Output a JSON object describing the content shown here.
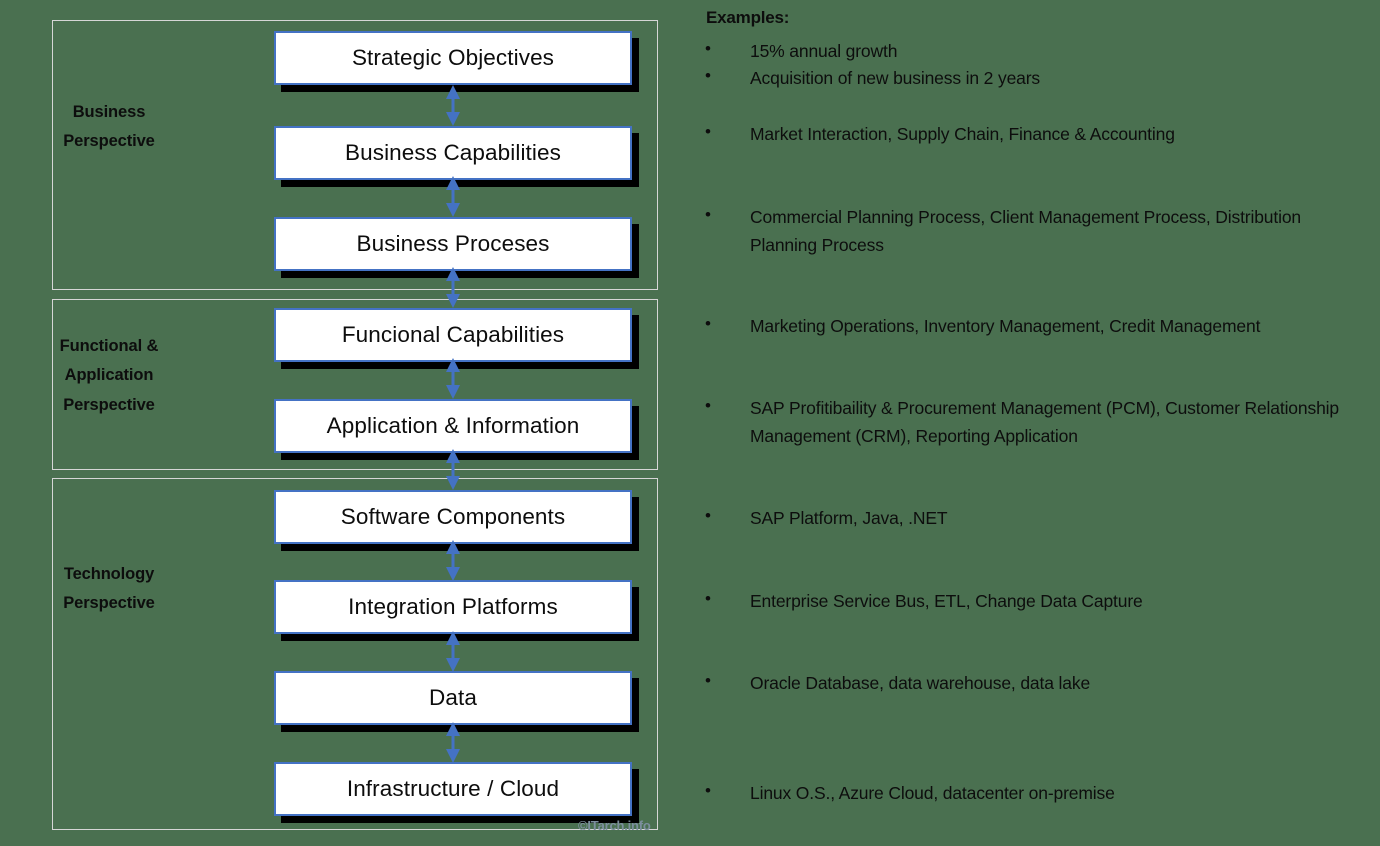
{
  "colors": {
    "background_green": "#4a7050",
    "panel_border": "#d6d6d6",
    "box_border_blue": "#4472c4",
    "box_fill": "#ffffff",
    "box_shadow": "#000000",
    "arrow_blue": "#4472c4",
    "text_dark": "#0d0d0d",
    "watermark": "#7c8f9e"
  },
  "diagram": {
    "perspectives": [
      {
        "id": "business",
        "label": "Business\nPerspective"
      },
      {
        "id": "functional",
        "label": "Functional &\nApplication\nPerspective"
      },
      {
        "id": "technology",
        "label": "Technology\nPerspective"
      }
    ],
    "layers": [
      {
        "id": "strategic-objectives",
        "label": "Strategic Objectives"
      },
      {
        "id": "business-capabilities",
        "label": "Business Capabilities"
      },
      {
        "id": "business-processes",
        "label": "Business Proceses"
      },
      {
        "id": "functional-capabilities",
        "label": "Funcional Capabilities"
      },
      {
        "id": "application-information",
        "label": "Application & Information"
      },
      {
        "id": "software-components",
        "label": "Software Components"
      },
      {
        "id": "integration-platforms",
        "label": "Integration Platforms"
      },
      {
        "id": "data",
        "label": "Data"
      },
      {
        "id": "infrastructure-cloud",
        "label": "Infrastructure / Cloud"
      }
    ]
  },
  "examples": {
    "title": "Examples:",
    "bullet_glyph": "•",
    "items": [
      {
        "text": "15% annual growth"
      },
      {
        "text": "Acquisition of new business in 2 years"
      },
      {
        "text": "Market Interaction, Supply Chain, Finance & Accounting"
      },
      {
        "text": "Commercial Planning Process, Client Management Process, Distribution Planning Process"
      },
      {
        "text": "Marketing Operations, Inventory Management, Credit Management"
      },
      {
        "text": "SAP Profitibaility & Procurement Management (PCM), Customer Relationship Management (CRM), Reporting Application"
      },
      {
        "text": "SAP Platform, Java, .NET"
      },
      {
        "text": "Enterprise Service Bus, ETL, Change Data Capture"
      },
      {
        "text": "Oracle Database, data warehouse, data lake"
      },
      {
        "text": "Linux O.S., Azure Cloud, datacenter on-premise"
      }
    ]
  },
  "watermark": {
    "text": "©ITarch.info"
  }
}
